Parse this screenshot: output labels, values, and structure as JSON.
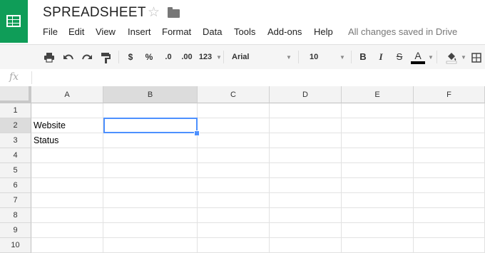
{
  "app": {
    "doc_title": "SPREADSHEET",
    "menu": [
      "File",
      "Edit",
      "View",
      "Insert",
      "Format",
      "Data",
      "Tools",
      "Add-ons",
      "Help"
    ],
    "save_status": "All changes saved in Drive"
  },
  "toolbar": {
    "currency": "$",
    "percent": "%",
    "dec_decrease": ".0",
    "dec_increase": ".00",
    "more_formats": "123",
    "font": "Arial",
    "font_size": "10",
    "bold": "B",
    "italic": "I",
    "strike": "S",
    "text_color": "A"
  },
  "formula_bar": {
    "fx": "fx",
    "value": ""
  },
  "sheet": {
    "columns": [
      "A",
      "B",
      "C",
      "D",
      "E",
      "F"
    ],
    "rows": [
      "1",
      "2",
      "3",
      "4",
      "5",
      "6",
      "7",
      "8",
      "9",
      "10"
    ],
    "cells": {
      "A2": "Website",
      "A3": "Status"
    },
    "selected_cell": "B2",
    "selected_column": "B",
    "selected_row": "2"
  },
  "colors": {
    "brand": "#0f9d58",
    "selection": "#4d90fe"
  }
}
